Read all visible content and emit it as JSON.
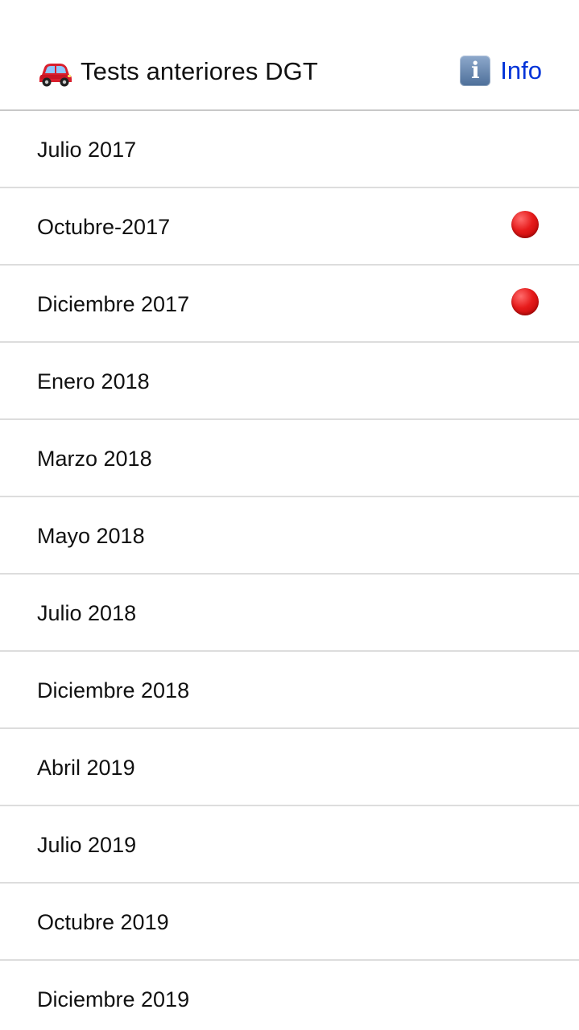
{
  "header": {
    "title": "Tests anteriores DGT",
    "title_icon": "red-car-icon",
    "info_icon": "information-icon",
    "info_label": "Info",
    "colors": {
      "info_link": "#0033d8"
    }
  },
  "list": {
    "items": [
      {
        "label": "Julio 2017",
        "marked": false
      },
      {
        "label": "Octubre-2017",
        "marked": true
      },
      {
        "label": "Diciembre 2017",
        "marked": true
      },
      {
        "label": "Enero 2018",
        "marked": false
      },
      {
        "label": "Marzo 2018",
        "marked": false
      },
      {
        "label": "Mayo 2018",
        "marked": false
      },
      {
        "label": "Julio 2018",
        "marked": false
      },
      {
        "label": "Diciembre 2018",
        "marked": false
      },
      {
        "label": "Abril 2019",
        "marked": false
      },
      {
        "label": "Julio 2019",
        "marked": false
      },
      {
        "label": "Octubre 2019",
        "marked": false
      },
      {
        "label": "Diciembre 2019",
        "marked": false
      }
    ],
    "marker_icon": "red-circle-icon",
    "marker_color": "#e61b1b"
  }
}
